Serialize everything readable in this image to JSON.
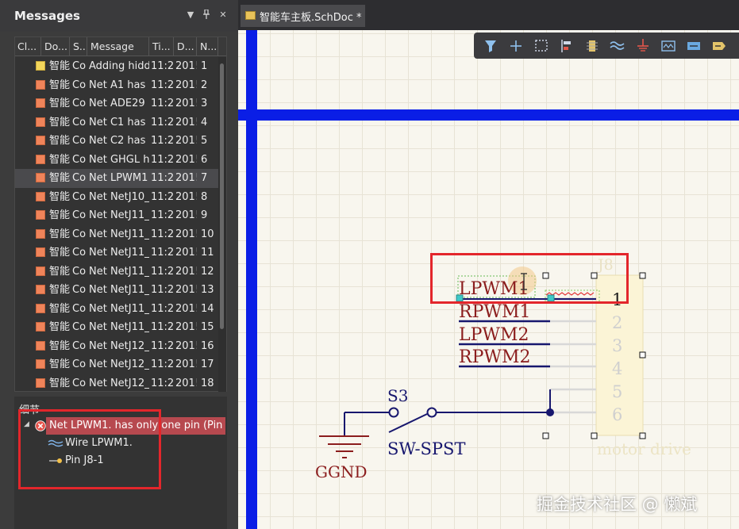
{
  "panel": {
    "title": "Messages",
    "columns": [
      "Cl...",
      "Do...",
      "S...",
      "Message",
      "Ti...",
      "D...",
      "N..."
    ],
    "messages": [
      {
        "icon": "warning-icon",
        "doc": "智能",
        "src": "Co",
        "message": "Adding hidd",
        "time": "11:2",
        "date": "201!",
        "no": "1"
      },
      {
        "icon": "error-icon",
        "doc": "智能",
        "src": "Co",
        "message": "Net A1 has",
        "time": "11:2",
        "date": "201!",
        "no": "2"
      },
      {
        "icon": "error-icon",
        "doc": "智能",
        "src": "Co",
        "message": "Net ADE29",
        "time": "11:2",
        "date": "201!",
        "no": "3"
      },
      {
        "icon": "error-icon",
        "doc": "智能",
        "src": "Co",
        "message": "Net C1 has",
        "time": "11:2",
        "date": "201!",
        "no": "4"
      },
      {
        "icon": "error-icon",
        "doc": "智能",
        "src": "Co",
        "message": "Net C2 has",
        "time": "11:2",
        "date": "201!",
        "no": "5"
      },
      {
        "icon": "error-icon",
        "doc": "智能",
        "src": "Co",
        "message": "Net GHGL h",
        "time": "11:2",
        "date": "201!",
        "no": "6"
      },
      {
        "icon": "error-icon",
        "doc": "智能",
        "src": "Co",
        "message": "Net LPWM1",
        "time": "11:2",
        "date": "201!",
        "no": "7"
      },
      {
        "icon": "error-icon",
        "doc": "智能",
        "src": "Co",
        "message": "Net NetJ10_",
        "time": "11:2",
        "date": "201!",
        "no": "8"
      },
      {
        "icon": "error-icon",
        "doc": "智能",
        "src": "Co",
        "message": "Net NetJ11_",
        "time": "11:2",
        "date": "201!",
        "no": "9"
      },
      {
        "icon": "error-icon",
        "doc": "智能",
        "src": "Co",
        "message": "Net NetJ11_",
        "time": "11:2",
        "date": "201!",
        "no": "10"
      },
      {
        "icon": "error-icon",
        "doc": "智能",
        "src": "Co",
        "message": "Net NetJ11_",
        "time": "11:2",
        "date": "201!",
        "no": "11"
      },
      {
        "icon": "error-icon",
        "doc": "智能",
        "src": "Co",
        "message": "Net NetJ11_",
        "time": "11:2",
        "date": "201!",
        "no": "12"
      },
      {
        "icon": "error-icon",
        "doc": "智能",
        "src": "Co",
        "message": "Net NetJ11_",
        "time": "11:2",
        "date": "201!",
        "no": "13"
      },
      {
        "icon": "error-icon",
        "doc": "智能",
        "src": "Co",
        "message": "Net NetJ11_",
        "time": "11:2",
        "date": "201!",
        "no": "14"
      },
      {
        "icon": "error-icon",
        "doc": "智能",
        "src": "Co",
        "message": "Net NetJ11_",
        "time": "11:2",
        "date": "201!",
        "no": "15"
      },
      {
        "icon": "error-icon",
        "doc": "智能",
        "src": "Co",
        "message": "Net NetJ12_",
        "time": "11:2",
        "date": "201!",
        "no": "16"
      },
      {
        "icon": "error-icon",
        "doc": "智能",
        "src": "Co",
        "message": "Net NetJ12_",
        "time": "11:2",
        "date": "201!",
        "no": "17"
      },
      {
        "icon": "error-icon",
        "doc": "智能",
        "src": "Co",
        "message": "Net NetJ12_",
        "time": "11:2",
        "date": "201!",
        "no": "18"
      }
    ],
    "selected_message_no": "7",
    "details": {
      "title": "细节",
      "error_text": "Net LPWM1. has only one pin (Pin .",
      "children": [
        "Wire LPWM1.",
        "Pin J8-1"
      ]
    }
  },
  "document": {
    "tab_label": "智能车主板.SchDoc *",
    "toolbar_icons": [
      "filter-icon",
      "add-icon",
      "select-rect-icon",
      "align-icon",
      "component-icon",
      "wire-icon",
      "power-port-icon",
      "bus-icon",
      "harness-icon",
      "net-label-icon"
    ]
  },
  "schematic": {
    "net_labels": [
      "LPWM1",
      "RPWM1",
      "LPWM2",
      "RPWM2"
    ],
    "pin_numbers": [
      "1",
      "2",
      "3",
      "4",
      "5",
      "6"
    ],
    "switch_designator": "S3",
    "switch_comment": "SW-SPST",
    "ground_label": "GGND",
    "component_comment": "motor drive",
    "component_designator": "J8"
  },
  "watermark": "掘金技术社区 @ 懒斌",
  "colors": {
    "border_blue": "#0a1ee6",
    "wire_navy": "#17176e",
    "net_label_red": "#8b1d1d",
    "error_highlight": "#b7494f",
    "annotation_red": "#e3262b",
    "error_icon": "#f0845a",
    "warning_icon": "#f3d65b"
  }
}
